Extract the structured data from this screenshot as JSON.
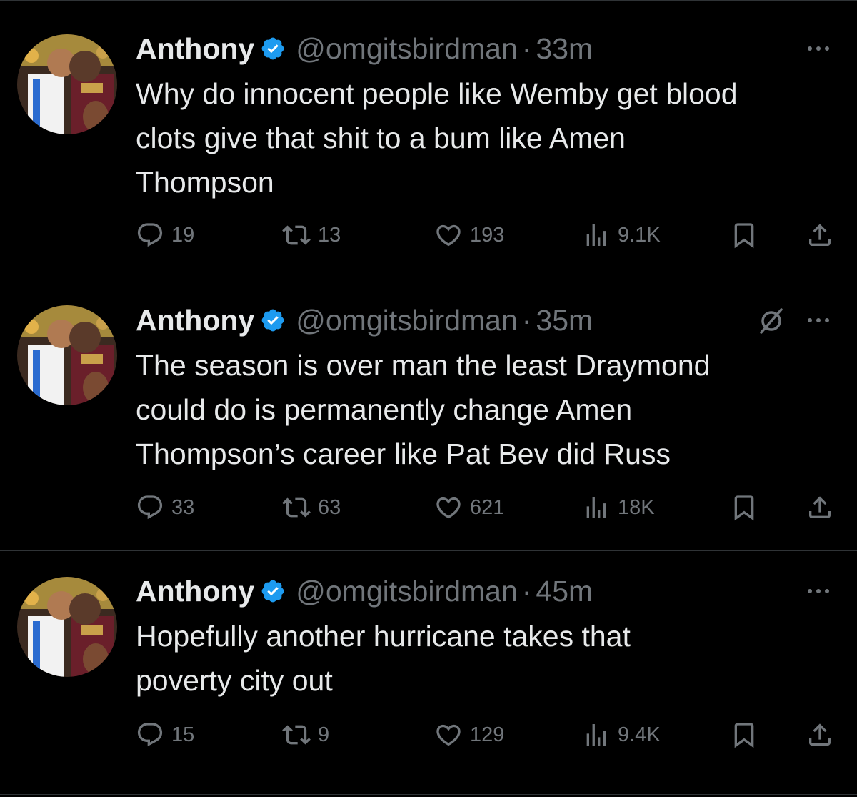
{
  "tweets": [
    {
      "name": "Anthony",
      "handle": "@omgitsbirdman",
      "separator": "·",
      "time": "33m",
      "text": "Why do innocent people like Wemby get blood\nclots give that shit to a bum like Amen\nThompson",
      "stats": {
        "replies": "19",
        "reposts": "13",
        "likes": "193",
        "views": "9.1K"
      },
      "has_grok": false
    },
    {
      "name": "Anthony",
      "handle": "@omgitsbirdman",
      "separator": "·",
      "time": "35m",
      "text": "The season is over man the least Draymond\ncould do is permanently change Amen\nThompson’s career like Pat Bev did Russ",
      "stats": {
        "replies": "33",
        "reposts": "63",
        "likes": "621",
        "views": "18K"
      },
      "has_grok": true
    },
    {
      "name": "Anthony",
      "handle": "@omgitsbirdman",
      "separator": "·",
      "time": "45m",
      "text": "Hopefully another hurricane takes that\npoverty city out",
      "stats": {
        "replies": "15",
        "reposts": "9",
        "likes": "129",
        "views": "9.4K"
      },
      "has_grok": false
    }
  ],
  "icons": {
    "verified": "verified-badge-icon",
    "more": "more-options-icon",
    "grok": "grok-icon",
    "reply": "reply-icon",
    "repost": "repost-icon",
    "like": "heart-icon",
    "views": "views-icon",
    "bookmark": "bookmark-icon",
    "share": "share-icon"
  },
  "colors": {
    "background": "#000000",
    "text_primary": "#e7e9ea",
    "text_secondary": "#71767b",
    "verified_blue": "#1d9bf0",
    "divider": "#2f3336"
  }
}
